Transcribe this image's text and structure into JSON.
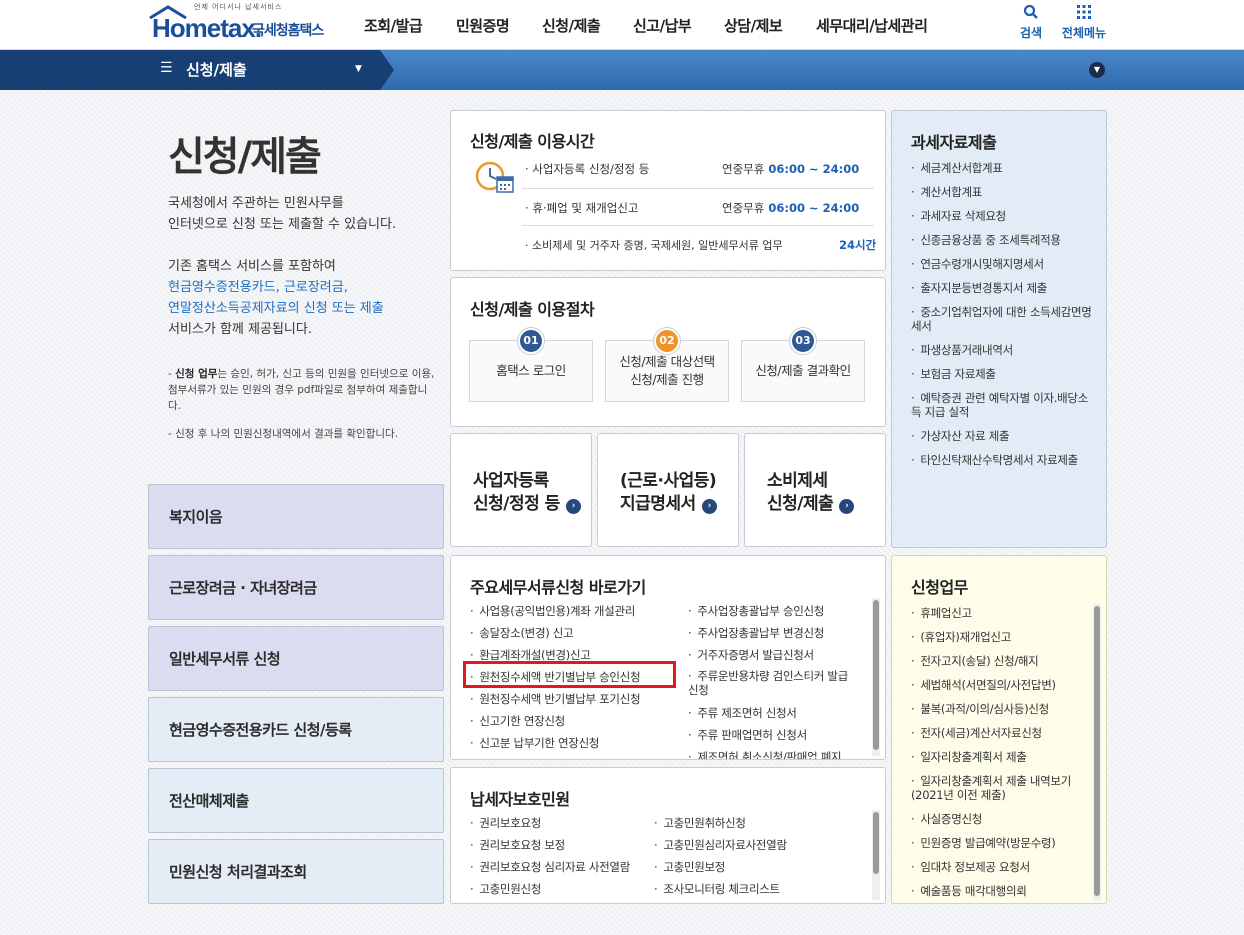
{
  "header": {
    "logo_tagline": "언제 어디서나 납세서비스",
    "logo_main": "Hometax.",
    "logo_kr": "국세청홈택스",
    "nav": [
      "조회/발급",
      "민원증명",
      "신청/제출",
      "신고/납부",
      "상담/제보",
      "세무대리/납세관리"
    ],
    "search_label": "검색",
    "allmenu_label": "전체메뉴"
  },
  "subbar": {
    "title": "신청/제출"
  },
  "intro": {
    "page_title": "신청/제출",
    "line1": "국세청에서 주관하는 민원사무를",
    "line2": "인터넷으로 신청 또는 제출할 수 있습니다.",
    "line3": "기존 홈택스 서비스를 포함하여",
    "line4": "현금영수증전용카드, 근로장려금,",
    "line5": "연말정산소득공제자료의 신청 또는 제출",
    "line6": "서비스가 함께 제공됩니다.",
    "note1_bold": "신청 업무",
    "note1_rest": "는 승인, 허가, 신고 등의 민원을 인터넷으로 이용, 첨부서류가 있는 민원의 경우 pdf파일로 첨부하여 제출합니다.",
    "note2": "신청 후 나의 민원신청내역에서 결과를 확인합니다."
  },
  "left_buttons": [
    "복지이음",
    "근로장려금 · 자녀장려금",
    "일반세무서류 신청",
    "현금영수증전용카드 신청/등록",
    "전산매체제출",
    "민원신청 처리결과조회"
  ],
  "hours": {
    "title": "신청/제출 이용시간",
    "rows": [
      {
        "label": "사업자등록 신청/정정 등",
        "days": "연중무휴",
        "time": "06:00 ~ 24:00"
      },
      {
        "label": "휴·폐업 및 재개업신고",
        "days": "연중무휴",
        "time": "06:00 ~ 24:00"
      },
      {
        "label": "소비제세 및 거주자 증명, 국제세원, 일반세무서류 업무",
        "days": "",
        "time": "24시간"
      }
    ]
  },
  "procedure": {
    "title": "신청/제출 이용절차",
    "steps": [
      {
        "num": "01",
        "l1": "홈택스 로그인",
        "l2": ""
      },
      {
        "num": "02",
        "l1": "신청/제출 대상선택",
        "l2": "신청/제출 진행"
      },
      {
        "num": "03",
        "l1": "신청/제출 결과확인",
        "l2": ""
      }
    ]
  },
  "shortcuts": [
    {
      "l1": "사업자등록",
      "l2": "신청/정정 등"
    },
    {
      "l1": "(근로·사업등)",
      "l2": "지급명세서"
    },
    {
      "l1": "소비제세",
      "l2": "신청/제출"
    }
  ],
  "major_docs": {
    "title": "주요세무서류신청 바로가기",
    "col1": [
      "사업용(공익법인용)계좌 개설관리",
      "송달장소(변경) 신고",
      "환급계좌개설(변경)신고",
      "원천징수세액 반기별납부 승인신청",
      "원천징수세액 반기별납부 포기신청",
      "신고기한 연장신청",
      "신고분 납부기한 연장신청"
    ],
    "col2": [
      "주사업장총괄납부 승인신청",
      "주사업장총괄납부 변경신청",
      "거주자증명서 발급신청서",
      "주류운반용차량 검인스티커 발급신청",
      "주류 제조면허 신청서",
      "주류 판매업면허 신청서",
      "제조면허 취소신청/판매업 폐지"
    ]
  },
  "protection": {
    "title": "납세자보호민원",
    "col1": [
      "권리보호요청",
      "권리보호요청 보정",
      "권리보호요청 심리자료 사전열람",
      "고충민원신청"
    ],
    "col2": [
      "고충민원취하신청",
      "고충민원심리자료사전열람",
      "고충민원보정",
      "조사모니터링 체크리스트"
    ]
  },
  "tax_data": {
    "title": "과세자료제출",
    "items": [
      "세금계산서합계표",
      "계산서합계표",
      "과세자료 삭제요청",
      "신종금융상품 중 조세특례적용",
      "연금수령개시및해지명세서",
      "출자지분등변경통지서 제출",
      "중소기업취업자에 대한 소득세감면명세서",
      "파생상품거래내역서",
      "보험금 자료제출",
      "예탁증권 관련 예탁자별 이자.배당소득 지급 실적",
      "가상자산 자료 제출",
      "타인신탁재산수탁명세서 자료제출"
    ]
  },
  "apply_work": {
    "title": "신청업무",
    "items": [
      "휴폐업신고",
      "(휴업자)재개업신고",
      "전자고지(송달) 신청/해지",
      "세법해석(서면질의/사전답변)",
      "불복(과적/이의/심사등)신청",
      "전자(세금)계산서자료신청",
      "일자리창출계획서 제출",
      "일자리창출계획서 제출 내역보기(2021년 이전 제출)",
      "사실증명신청",
      "민원증명 발급예약(방문수령)",
      "임대차 정보제공 요청서",
      "예술품등 매각대행의뢰"
    ]
  },
  "colors": {
    "step1": "#2d5a96",
    "step2": "#f0932b",
    "step3": "#2d5a96",
    "highlight": "#e3171e"
  }
}
